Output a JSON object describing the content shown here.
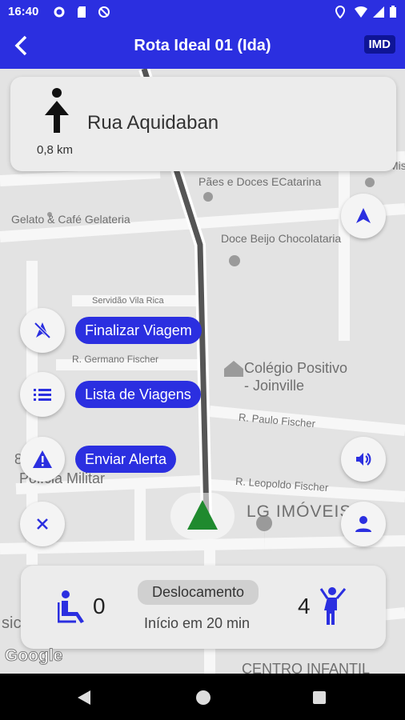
{
  "status_bar": {
    "time": "16:40"
  },
  "app_bar": {
    "title": "Rota Ideal 01 (Ida)",
    "badge": "IMD"
  },
  "nav_card": {
    "street": "Rua Aquidaban",
    "distance": "0,8 km"
  },
  "map_labels": {
    "paes": "Pães e Doces ECatarina",
    "mis": "Mis",
    "gelato": "Gelato & Café Gelateria",
    "doce_beijo": "Doce Beijo Chocolataria",
    "servidao": "Servidão Vila Rica",
    "germano": "R. Germano Fischer",
    "colegio_1": "Colégio Positivo",
    "colegio_2": "- Joinville",
    "paulo": "R. Paulo Fischer",
    "policia_1": "8",
    "policia_2": "Polícia Militar",
    "leopoldo": "R. Leopoldo Fischer",
    "lg": "LG IMÓVEIS",
    "sic": "sic",
    "centro": "CENTRO INFANTIL"
  },
  "actions": {
    "finalizar": "Finalizar Viagem",
    "lista": "Lista de Viagens",
    "alerta": "Enviar Alerta"
  },
  "trip_card": {
    "seated_count": "0",
    "status": "Deslocamento",
    "eta": "Início em 20 min",
    "standing_count": "4"
  },
  "google_logo": "Google",
  "colors": {
    "primary": "#2b2fe0",
    "badge_bg": "#0f1596",
    "arrow_green": "#1f8a2e"
  }
}
